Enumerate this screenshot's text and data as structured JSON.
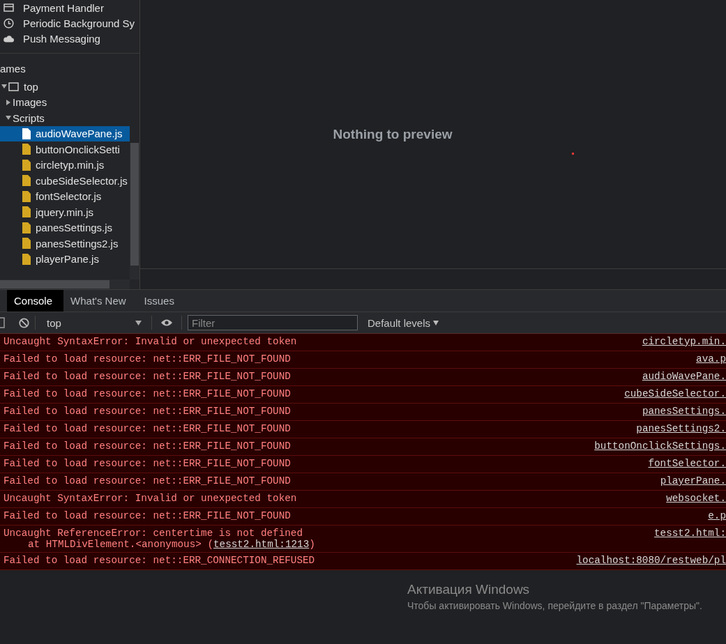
{
  "sidebar": {
    "services": [
      {
        "label": "Payment Handler",
        "kind": "card"
      },
      {
        "label": "Periodic Background Sy",
        "kind": "clock"
      },
      {
        "label": "Push Messaging",
        "kind": "cloud"
      }
    ],
    "frames_heading": "ames",
    "tree": [
      {
        "label": "top",
        "kind": "frame",
        "expanded": true,
        "selected": false,
        "children": [
          {
            "label": "Images",
            "expanded": false,
            "selected": false
          },
          {
            "label": "Scripts",
            "expanded": true,
            "selected": false,
            "children": [
              {
                "label": "audioWavePane.js",
                "kind": "file",
                "selected": true
              },
              {
                "label": "buttonOnclickSetti",
                "kind": "file",
                "selected": false
              },
              {
                "label": "circletyp.min.js",
                "kind": "file",
                "selected": false
              },
              {
                "label": "cubeSideSelector.js",
                "kind": "file",
                "selected": false
              },
              {
                "label": "fontSelector.js",
                "kind": "file",
                "selected": false
              },
              {
                "label": "jquery.min.js",
                "kind": "file",
                "selected": false
              },
              {
                "label": "panesSettings.js",
                "kind": "file",
                "selected": false
              },
              {
                "label": "panesSettings2.js",
                "kind": "file",
                "selected": false
              },
              {
                "label": "playerPane.js",
                "kind": "file",
                "selected": false
              }
            ]
          }
        ]
      }
    ]
  },
  "preview": {
    "empty_message": "Nothing to preview"
  },
  "drawer": {
    "tabs": [
      {
        "label": "Console",
        "selected": true
      },
      {
        "label": "What's New",
        "selected": false
      },
      {
        "label": "Issues",
        "selected": false
      }
    ],
    "toolbar": {
      "context": "top",
      "filter_placeholder": "Filter",
      "levels": "Default levels"
    },
    "messages": [
      {
        "text": "Uncaught SyntaxError: Invalid or unexpected token",
        "source": "circletyp.min."
      },
      {
        "text": "Failed to load resource: net::ERR_FILE_NOT_FOUND",
        "source": "ava.p"
      },
      {
        "text": "Failed to load resource: net::ERR_FILE_NOT_FOUND",
        "source": "audioWavePane."
      },
      {
        "text": "Failed to load resource: net::ERR_FILE_NOT_FOUND",
        "source": "cubeSideSelector."
      },
      {
        "text": "Failed to load resource: net::ERR_FILE_NOT_FOUND",
        "source": "panesSettings."
      },
      {
        "text": "Failed to load resource: net::ERR_FILE_NOT_FOUND",
        "source": "panesSettings2."
      },
      {
        "text": "Failed to load resource: net::ERR_FILE_NOT_FOUND",
        "source": "buttonOnclickSettings."
      },
      {
        "text": "Failed to load resource: net::ERR_FILE_NOT_FOUND",
        "source": "fontSelector."
      },
      {
        "text": "Failed to load resource: net::ERR_FILE_NOT_FOUND",
        "source": "playerPane."
      },
      {
        "text": "Uncaught SyntaxError: Invalid or unexpected token",
        "source": "websocket."
      },
      {
        "text": "Failed to load resource: net::ERR_FILE_NOT_FOUND",
        "source": "e.p"
      },
      {
        "text": "Uncaught ReferenceError: centertime is not defined",
        "source": "tesst2.html:",
        "stack": {
          "prefix": "at HTMLDivElement.<anonymous> (",
          "link": "tesst2.html:1213",
          "suffix": ")"
        }
      },
      {
        "text": "Failed to load resource: net::ERR_CONNECTION_REFUSED",
        "source": "localhost:8080/restweb/pl"
      }
    ]
  },
  "os_notice": {
    "title": "Активация Windows",
    "body": "Чтобы активировать Windows, перейдите в раздел \"Параметры\"."
  }
}
